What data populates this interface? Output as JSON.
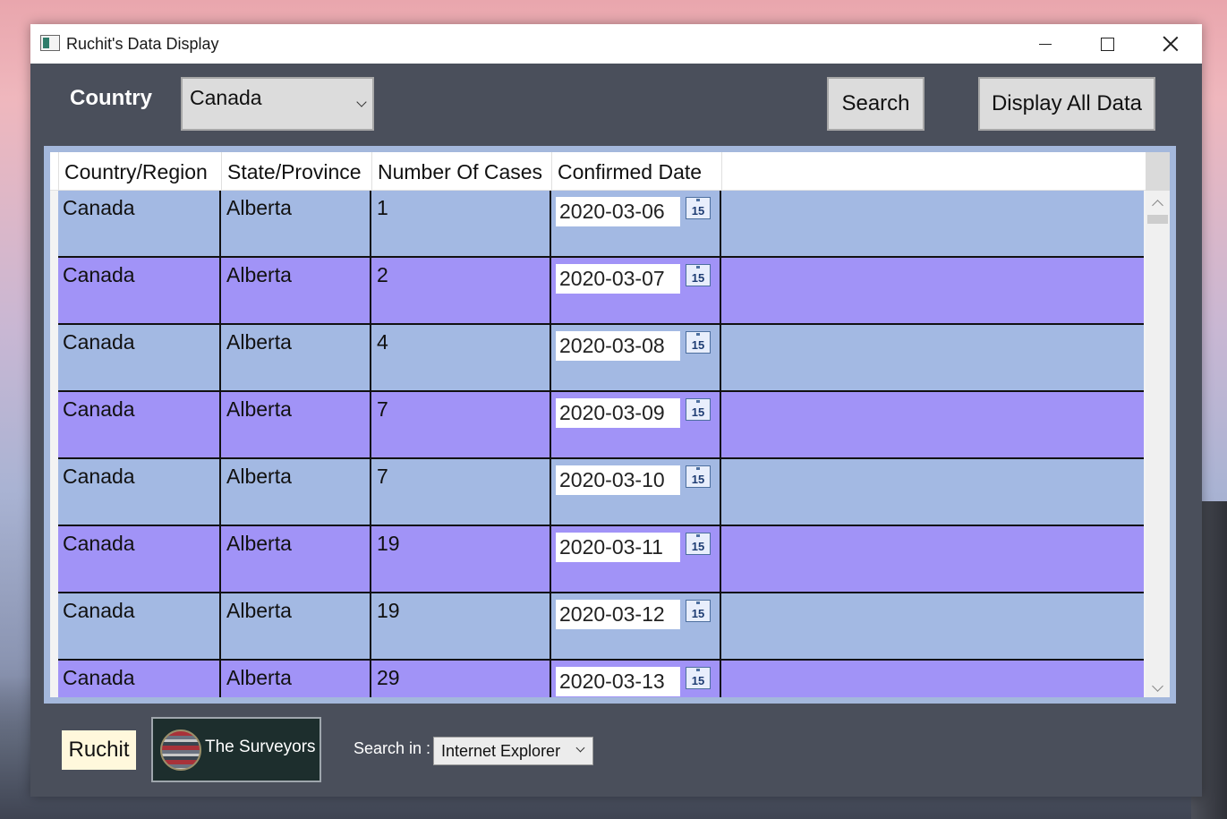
{
  "window": {
    "title": "Ruchit's Data Display"
  },
  "filter": {
    "country_label": "Country",
    "country_value": "Canada",
    "search_label": "Search",
    "display_all_label": "Display All Data"
  },
  "grid": {
    "columns": [
      "Country/Region",
      "State/Province",
      "Number Of Cases",
      "Confirmed Date"
    ],
    "calendar_glyph": "15",
    "rows": [
      {
        "country": "Canada",
        "province": "Alberta",
        "cases": "1",
        "date": "2020-03-06"
      },
      {
        "country": "Canada",
        "province": "Alberta",
        "cases": "2",
        "date": "2020-03-07"
      },
      {
        "country": "Canada",
        "province": "Alberta",
        "cases": "4",
        "date": "2020-03-08"
      },
      {
        "country": "Canada",
        "province": "Alberta",
        "cases": "7",
        "date": "2020-03-09"
      },
      {
        "country": "Canada",
        "province": "Alberta",
        "cases": "7",
        "date": "2020-03-10"
      },
      {
        "country": "Canada",
        "province": "Alberta",
        "cases": "19",
        "date": "2020-03-11"
      },
      {
        "country": "Canada",
        "province": "Alberta",
        "cases": "19",
        "date": "2020-03-12"
      },
      {
        "country": "Canada",
        "province": "Alberta",
        "cases": "29",
        "date": "2020-03-13"
      }
    ]
  },
  "footer": {
    "ruchit_label": "Ruchit",
    "surveyors_label": "The Surveyors",
    "search_in_label": "Search in :",
    "browser_value": "Internet Explorer"
  },
  "colors": {
    "window_bg": "#4a4f5b",
    "row_a": "#a3b9e3",
    "row_b": "#a193f7",
    "ruchit_bg": "#fff8dc",
    "surveyors_bg": "#1d2e2d"
  }
}
